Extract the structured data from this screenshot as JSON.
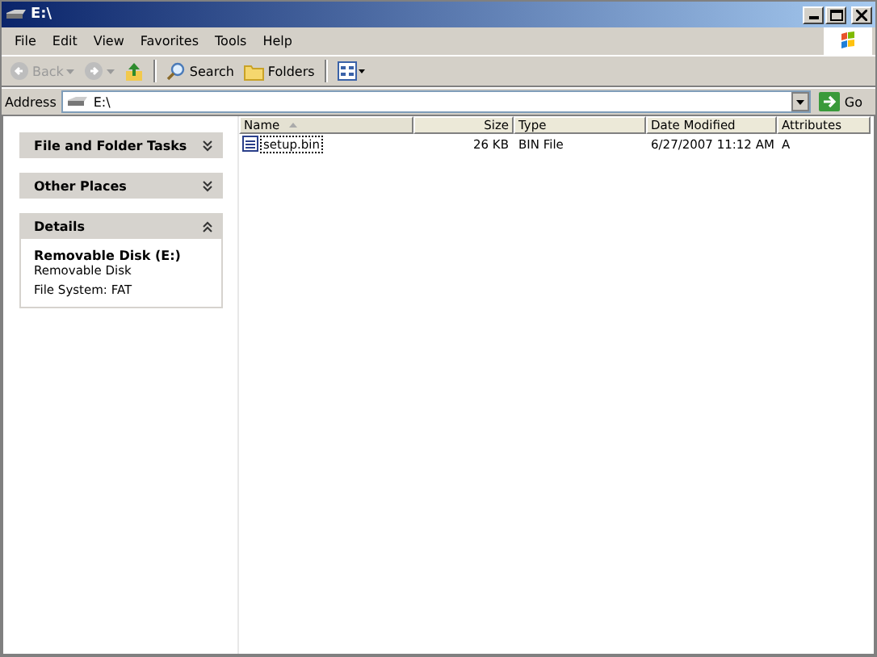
{
  "window": {
    "title": "E:\\"
  },
  "menu": [
    "File",
    "Edit",
    "View",
    "Favorites",
    "Tools",
    "Help"
  ],
  "toolbar": [
    {
      "kind": "back",
      "label": "Back",
      "disabled": true
    },
    {
      "kind": "forward",
      "disabled": true
    },
    {
      "kind": "up"
    },
    {
      "kind": "search",
      "label": "Search"
    },
    {
      "kind": "folders",
      "label": "Folders"
    },
    {
      "kind": "views"
    }
  ],
  "address": {
    "label": "Address",
    "value": "E:\\",
    "go": "Go"
  },
  "task_panes": [
    {
      "title": "File and Folder Tasks",
      "expanded": false
    },
    {
      "title": "Other Places",
      "expanded": false
    },
    {
      "title": "Details",
      "expanded": true,
      "name": "Removable Disk (E:)",
      "lines": [
        "Removable Disk",
        "File System: FAT"
      ]
    }
  ],
  "table": {
    "columns": [
      {
        "label": "Name",
        "sorted": true
      },
      {
        "label": "Size",
        "sorted": false
      },
      {
        "label": "Type",
        "sorted": false
      },
      {
        "label": "Date Modified",
        "sorted": false
      },
      {
        "label": "Attributes",
        "sorted": false
      }
    ],
    "rows": [
      {
        "selected": true,
        "cells": [
          "setup.bin",
          "26 KB",
          "BIN File",
          "6/27/2007 11:12 AM",
          "A"
        ]
      }
    ]
  }
}
